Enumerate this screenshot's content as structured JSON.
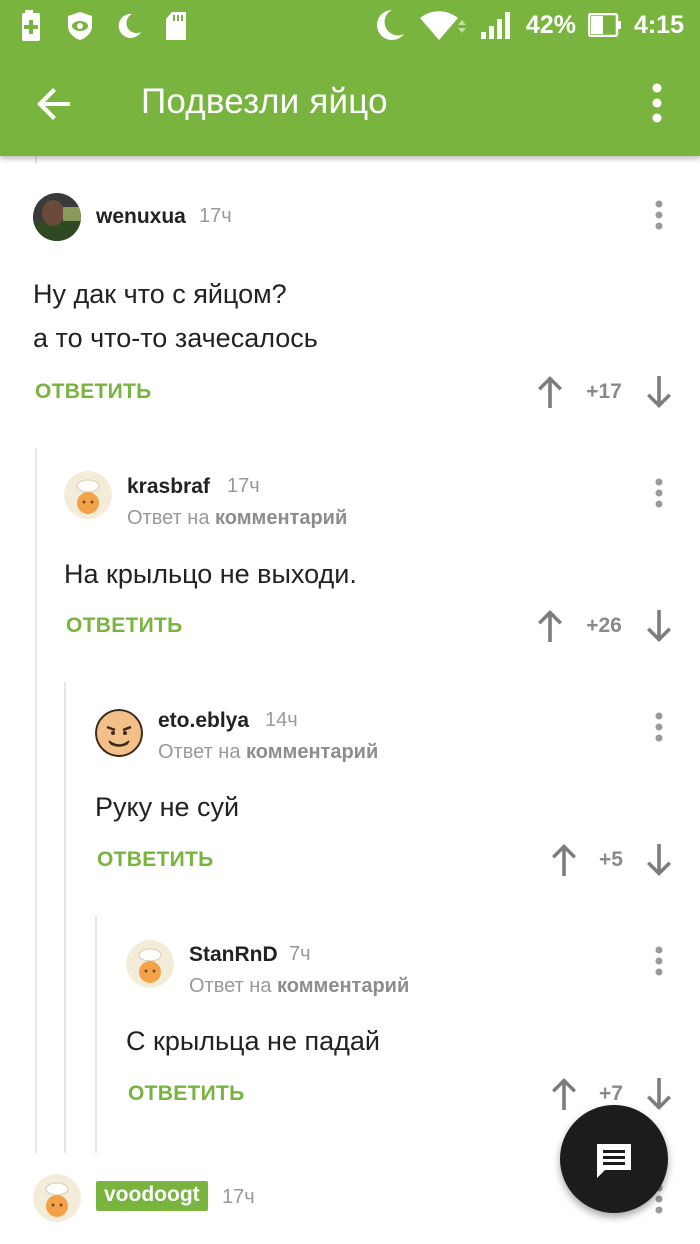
{
  "status_bar": {
    "battery_percent": "42%",
    "time": "4:15",
    "icons": [
      "battery-saver-icon",
      "eye-shield-icon",
      "moon-icon",
      "sd-card-icon",
      "moon-icon",
      "wifi-icon",
      "signal-icon",
      "battery-icon"
    ]
  },
  "app_bar": {
    "title": "Подвезли яйцо",
    "back_icon": "arrow-back-icon",
    "menu_icon": "more-vert-icon"
  },
  "reply_prefix": "Ответ на",
  "reply_target": "комментарий",
  "reply_label": "ОТВЕТИТЬ",
  "comments": [
    {
      "user": "wenuxua",
      "time": "17ч",
      "lines": [
        "Ну дак что с яйцом?",
        "а то что-то зачесалось"
      ],
      "score": "+17",
      "is_reply": false
    },
    {
      "user": "krasbraf",
      "time": "17ч",
      "lines": [
        "На крыльцо не выходи."
      ],
      "score": "+26",
      "is_reply": true
    },
    {
      "user": "eto.eblya",
      "time": "14ч",
      "lines": [
        "Руку не суй"
      ],
      "score": "+5",
      "is_reply": true
    },
    {
      "user": "StanRnD",
      "time": "7ч",
      "lines": [
        "С крыльца не падай"
      ],
      "score": "+7",
      "is_reply": true
    },
    {
      "user": "voodoogt",
      "time": "17ч",
      "is_author": true
    }
  ],
  "colors": {
    "brand_green": "#79b43f",
    "fab": "#1c1c1c",
    "text_gray": "#999999"
  },
  "fab_icon": "comment-icon"
}
